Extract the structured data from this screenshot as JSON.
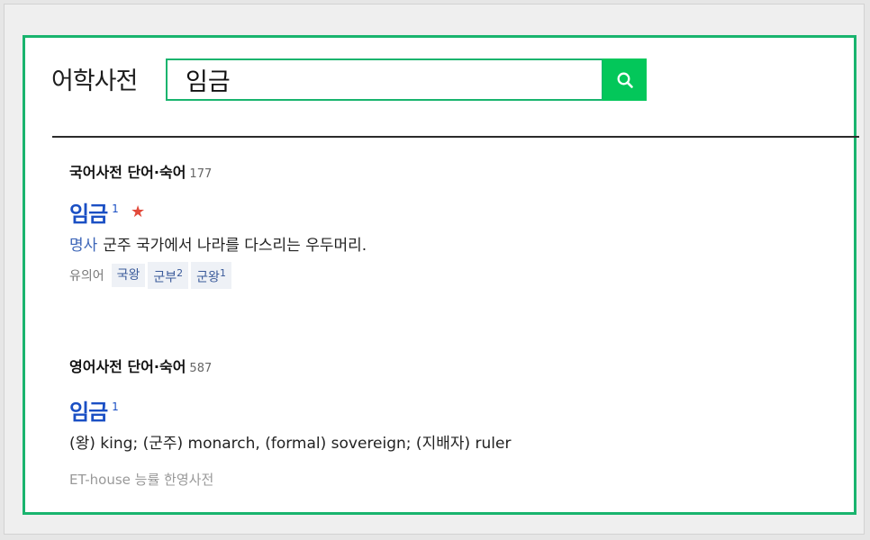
{
  "header": {
    "dict_title": "어학사전",
    "search_value": "임금"
  },
  "korean_section": {
    "title": "국어사전 단어·숙어",
    "count": "177",
    "entry": {
      "word": "임금",
      "homonym_number": "1",
      "pos": "명사",
      "definition": "군주 국가에서 나라를 다스리는 우두머리.",
      "synonym_label": "유의어",
      "synonyms": [
        {
          "word": "국왕",
          "num": ""
        },
        {
          "word": "군부",
          "num": "2"
        },
        {
          "word": "군왕",
          "num": "1"
        }
      ]
    }
  },
  "english_section": {
    "title": "영어사전 단어·숙어",
    "count": "587",
    "entry": {
      "word": "임금",
      "homonym_number": "1",
      "definition": "(왕) king; (군주) monarch, (formal) sovereign; (지배자) ruler",
      "source": "ET-house 능률 한영사전"
    }
  },
  "colors": {
    "accent_green": "#03c75a",
    "link_blue": "#1a4fc4",
    "star_red": "#e24a3b"
  },
  "icons": {
    "search": "search-icon",
    "star": "star-icon"
  }
}
